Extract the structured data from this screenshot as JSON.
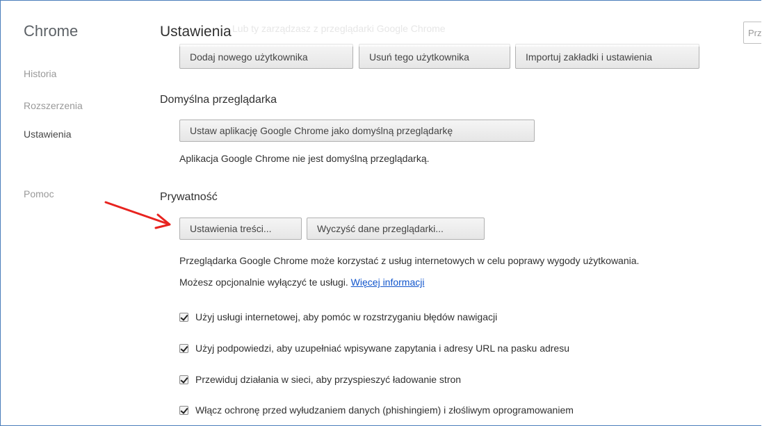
{
  "sidebar": {
    "brand": "Chrome",
    "items": [
      {
        "label": "Historia",
        "active": false
      },
      {
        "label": "Rozszerzenia",
        "active": false
      },
      {
        "label": "Ustawienia",
        "active": true
      },
      {
        "label": "Pomoc",
        "active": false
      }
    ]
  },
  "header": {
    "title": "Ustawienia",
    "ghost_text": "Lub ty zarządzasz z przeglądarki Google Chrome",
    "search_placeholder": "Prze"
  },
  "users": {
    "buttons": [
      "Dodaj nowego użytkownika",
      "Usuń tego użytkownika",
      "Importuj zakładki i ustawienia"
    ]
  },
  "default_browser": {
    "heading": "Domyślna przeglądarka",
    "button": "Ustaw aplikację Google Chrome jako domyślną przeglądarkę",
    "status": "Aplikacja Google Chrome nie jest domyślną przeglądarką."
  },
  "privacy": {
    "heading": "Prywatność",
    "content_settings_button": "Ustawienia treści...",
    "clear_data_button": "Wyczyść dane przeglądarki...",
    "desc_line1": "Przeglądarka Google Chrome może korzystać z usług internetowych w celu poprawy wygody użytkowania.",
    "desc_line2": "Możesz opcjonalnie wyłączyć te usługi.",
    "more_info_link": "Więcej informacji",
    "checkboxes": [
      {
        "label": "Użyj usługi internetowej, aby pomóc w rozstrzyganiu błędów nawigacji",
        "checked": true
      },
      {
        "label": "Użyj podpowiedzi, aby uzupełniać wpisywane zapytania i adresy URL na pasku adresu",
        "checked": true
      },
      {
        "label": "Przewiduj działania w sieci, aby przyspieszyć ładowanie stron",
        "checked": true
      },
      {
        "label": "Włącz ochronę przed wyłudzaniem danych (phishingiem) i złośliwym oprogramowaniem",
        "checked": true
      }
    ]
  },
  "annotation": {
    "arrow_color": "#e8231f"
  },
  "colors": {
    "accent_link": "#1155cc",
    "frame_border": "#4a7ebb"
  }
}
